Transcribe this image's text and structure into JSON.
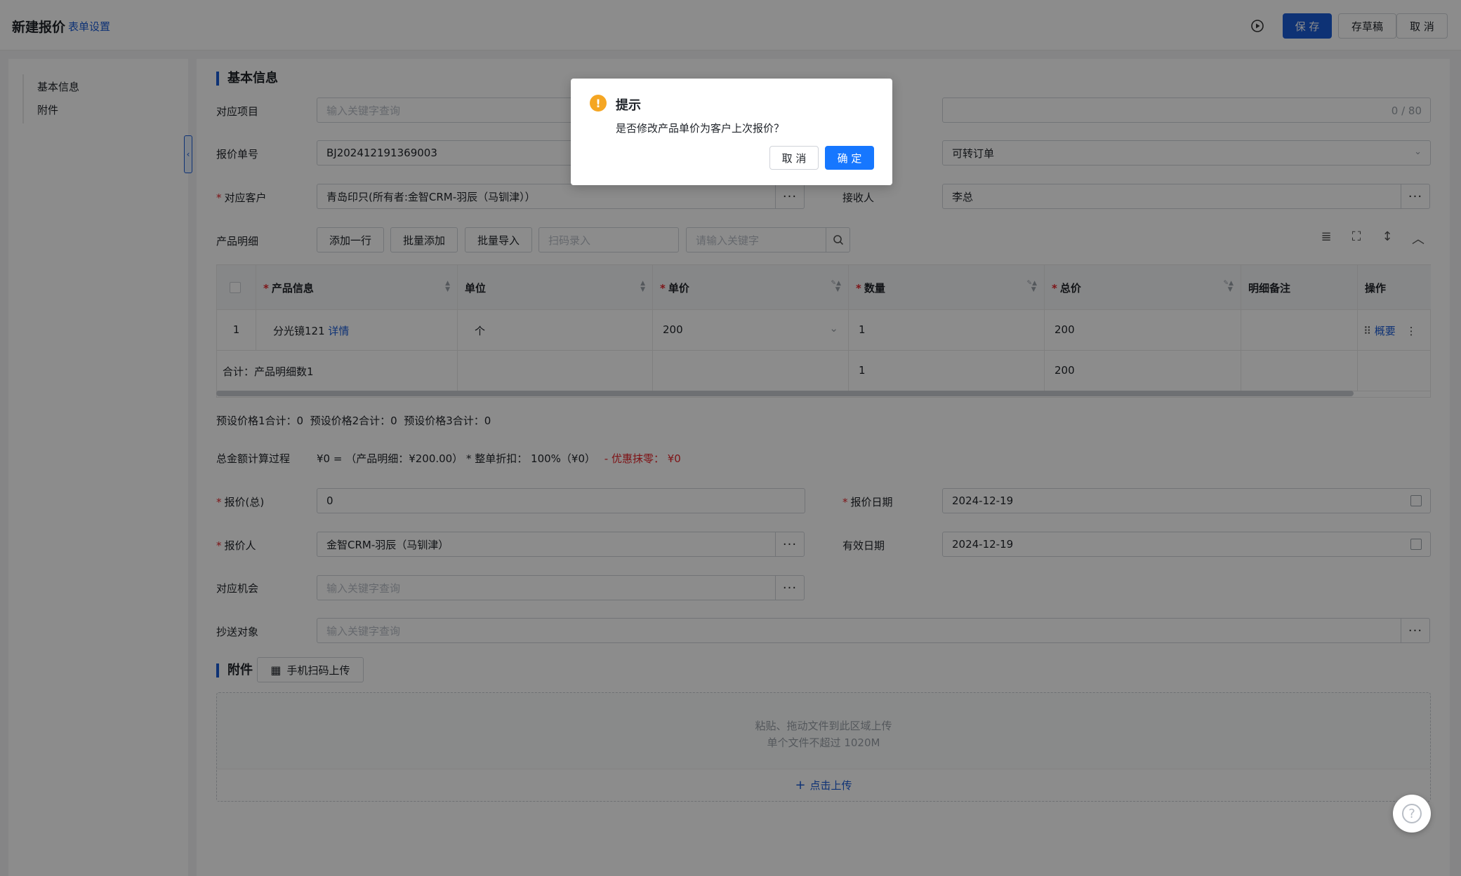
{
  "header": {
    "title": "新建报价",
    "form_settings": "表单设置",
    "save": "保 存",
    "draft": "存草稿",
    "cancel": "取 消"
  },
  "sidebar": {
    "items": [
      {
        "label": "基本信息"
      },
      {
        "label": "附件"
      }
    ]
  },
  "basic": {
    "section_title": "基本信息",
    "project_label": "对应项目",
    "project_placeholder": "输入关键字查询",
    "subject_counter": "0 / 80",
    "quote_no_label": "报价单号",
    "quote_no_value": "BJ202412191369003",
    "status_value": "可转订单",
    "customer_label": "对应客户",
    "customer_value": "青岛印只(所有者:金智CRM-羽辰（马钏津））",
    "receiver_label": "接收人",
    "receiver_value": "李总"
  },
  "products": {
    "label": "产品明细",
    "add_row": "添加一行",
    "batch_add": "批量添加",
    "batch_import": "批量导入",
    "scan_placeholder": "扫码录入",
    "search_placeholder": "请输入关键字",
    "columns": {
      "product": "产品信息",
      "unit": "单位",
      "price": "单价",
      "qty": "数量",
      "total": "总价",
      "remark": "明细备注",
      "ops": "操作"
    },
    "row": {
      "index": "1",
      "product": "分光镜121",
      "detail_link": "详情",
      "unit": "个",
      "price": "200",
      "qty": "1",
      "total": "200",
      "summary_link": "概要"
    },
    "sum_row": {
      "label": "合计：产品明细数1",
      "qty": "1",
      "total": "200"
    }
  },
  "preset_totals": "预设价格1合计：0  预设价格2合计：0  预设价格3合计：0",
  "calc": {
    "label": "总金额计算过程",
    "formula": "¥0 = （产品明细：¥200.00） * 整单折扣： 100%（¥0）",
    "discount": "- 优惠抹零： ¥0"
  },
  "quote": {
    "total_label": "报价(总)",
    "total_value": "0",
    "date_label": "报价日期",
    "date_value": "2024-12-19",
    "person_label": "报价人",
    "person_value": "金智CRM-羽辰（马钏津）",
    "valid_label": "有效日期",
    "valid_value": "2024-12-19",
    "chance_label": "对应机会",
    "chance_placeholder": "输入关键字查询",
    "cc_label": "抄送对象",
    "cc_placeholder": "输入关键字查询"
  },
  "attachments": {
    "section_title": "附件",
    "scan_upload": "手机扫码上传",
    "drop_hint": "粘贴、拖动文件到此区域上传",
    "size_hint": "单个文件不超过 1020M",
    "click_upload": "点击上传"
  },
  "dialog": {
    "title": "提示",
    "message": "是否修改产品单价为客户上次报价？",
    "cancel": "取 消",
    "ok": "确 定"
  },
  "icons": {
    "warning": "!",
    "dots": "···",
    "help": "?"
  },
  "colors": {
    "primary": "#1a5bd6",
    "danger": "#e5252a",
    "warning": "#f5a623"
  }
}
